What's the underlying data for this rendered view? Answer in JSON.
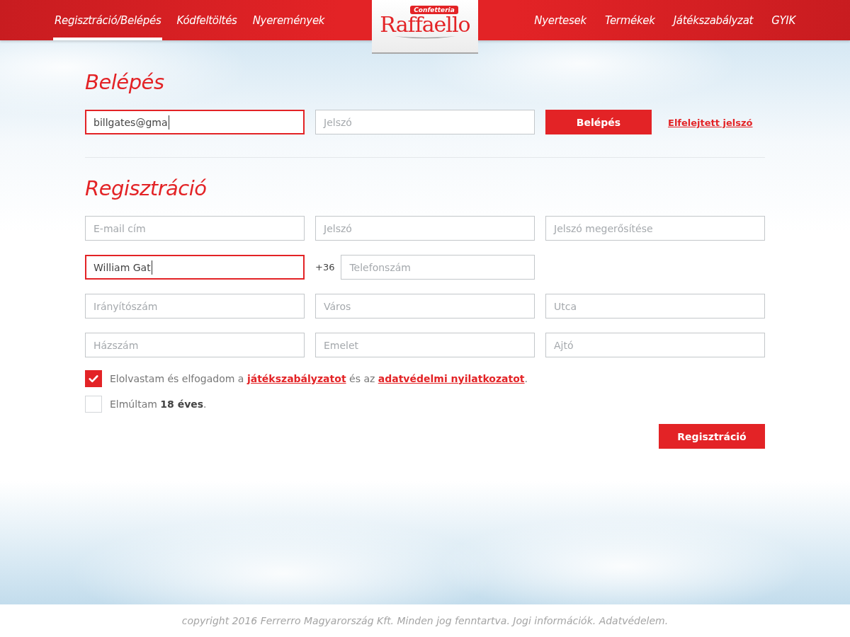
{
  "nav": {
    "left": [
      {
        "label": "Regisztráció/Belépés",
        "selected": true
      },
      {
        "label": "Kódfeltöltés",
        "selected": false
      },
      {
        "label": "Nyeremények",
        "selected": false
      }
    ],
    "logo": {
      "badge": "Confetteria",
      "wordmark": "Raffaello"
    },
    "right": [
      {
        "label": "Nyertesek",
        "selected": false
      },
      {
        "label": "Termékek",
        "selected": false
      },
      {
        "label": "Játékszabályzat",
        "selected": false
      },
      {
        "label": "GYIK",
        "selected": false
      }
    ]
  },
  "login": {
    "title": "Belépés",
    "fields": [
      {
        "kind": "text",
        "value": "billgates@gma",
        "focused": true
      },
      {
        "kind": "text",
        "placeholder": "Jelszó",
        "focused": false
      }
    ],
    "button": "Belépés",
    "forgot_link": "Elfelejtett jelszó"
  },
  "registration": {
    "title": "Regisztráció",
    "rows": [
      [
        {
          "kind": "text",
          "placeholder": "E-mail cím",
          "focused": false
        },
        {
          "kind": "text",
          "placeholder": "Jelszó",
          "focused": false
        },
        {
          "kind": "text",
          "placeholder": "Jelszó megerősítése",
          "focused": false
        }
      ],
      [
        {
          "kind": "text",
          "value": "William Gat",
          "focused": true
        },
        {
          "kind": "phone",
          "prefix": "+36",
          "placeholder": "Telefonszám",
          "focused": false
        }
      ],
      [
        {
          "kind": "text",
          "placeholder": "Irányítószám",
          "focused": false
        },
        {
          "kind": "text",
          "placeholder": "Város",
          "focused": false
        },
        {
          "kind": "text",
          "placeholder": "Utca",
          "focused": false
        }
      ],
      [
        {
          "kind": "text",
          "placeholder": "Házszám",
          "focused": false
        },
        {
          "kind": "text",
          "placeholder": "Emelet",
          "focused": false
        },
        {
          "kind": "text",
          "placeholder": "Ajtó",
          "focused": false
        }
      ]
    ],
    "checkboxes": [
      {
        "checked": true,
        "parts": [
          {
            "kind": "text",
            "text": "Elolvastam és elfogadom a "
          },
          {
            "kind": "link",
            "text": "játékszabályzatot"
          },
          {
            "kind": "text",
            "text": " és az "
          },
          {
            "kind": "link",
            "text": "adatvédelmi nyilatkozatot"
          },
          {
            "kind": "text",
            "text": "."
          }
        ]
      },
      {
        "checked": false,
        "parts": [
          {
            "kind": "text",
            "text": "Elmúltam **18 éves**."
          }
        ]
      }
    ],
    "button": "Regisztráció"
  },
  "footer": "copyright 2016 Ferrerro Magyarország Kft. Minden jog fenntartva. Jogi információk. Adatvédelem."
}
